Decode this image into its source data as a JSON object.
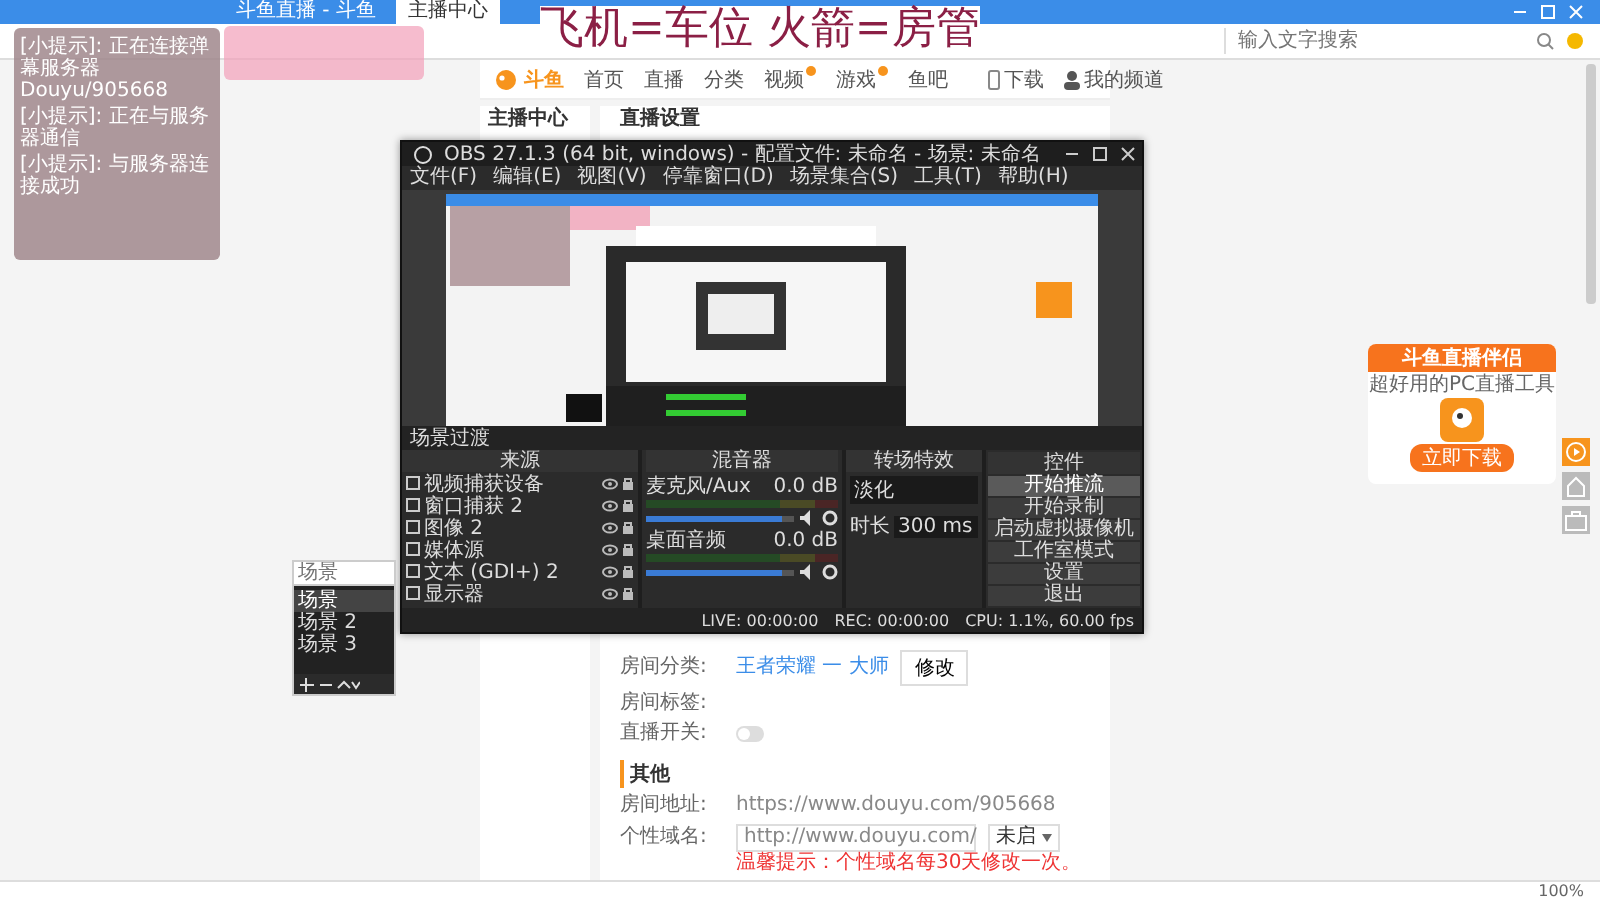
{
  "browser": {
    "tabs": [
      {
        "label": "斗鱼直播 - 斗鱼",
        "selected": false
      },
      {
        "label": "主播中心",
        "selected": true
      }
    ],
    "search": {
      "placeholder": "输入文字搜索"
    },
    "zoom": "100%"
  },
  "overlay_text": "飞机=车位 火箭=房管",
  "notes": [
    "[小提示]: 正在连接弹幕服务器 Douyu/905668",
    "[小提示]: 正在与服务器通信",
    "[小提示]: 与服务器连接成功"
  ],
  "site": {
    "logo": "斗鱼",
    "nav": [
      {
        "label": "首页",
        "hot": false
      },
      {
        "label": "直播",
        "hot": false
      },
      {
        "label": "分类",
        "hot": false
      },
      {
        "label": "视频",
        "hot": true
      },
      {
        "label": "游戏",
        "hot": true
      },
      {
        "label": "鱼吧",
        "hot": false
      }
    ],
    "download": "下载",
    "user": "我的频道"
  },
  "sidebar_title": "主播中心",
  "page_title": "直播设置",
  "settings": [
    {
      "label": "房间分类:",
      "value": "王者荣耀 一 大师",
      "button": "修改"
    },
    {
      "label": "房间标签:"
    },
    {
      "label": "直播开关:",
      "on": false
    }
  ],
  "other": {
    "title": "其他",
    "rows": [
      {
        "label": "房间地址:",
        "value": "https://www.douyu.com/905668"
      },
      {
        "label": "个性域名:",
        "value": "http://www.douyu.com/",
        "select": "未启",
        "hint": "温馨提示：个性域名每30天修改一次。"
      }
    ]
  },
  "obs": {
    "title": "OBS 27.1.3 (64 bit, windows) - 配置文件: 未命名 - 场景: 未命名",
    "menu": [
      "文件(F)",
      "编辑(E)",
      "视图(V)",
      "停靠窗口(D)",
      "场景集合(S)",
      "工具(T)",
      "帮助(H)"
    ],
    "transition_bar": "场景过渡",
    "scenes": {
      "placeholder": "场景",
      "items": [
        {
          "label": "场景",
          "selected": true
        },
        {
          "label": "场景 2",
          "selected": false
        },
        {
          "label": "场景 3",
          "selected": false
        }
      ]
    },
    "sources": {
      "title": "来源",
      "items": [
        "视频捕获设备",
        "窗口捕获 2",
        "图像 2",
        "媒体源",
        "文本 (GDI+) 2",
        "显示器"
      ]
    },
    "mixer": {
      "title": "混音器",
      "channels": [
        {
          "name": "麦克风/Aux",
          "reading": "0.0 dB",
          "level": 0.92
        },
        {
          "name": "桌面音频",
          "reading": "0.0 dB",
          "level": 0.92
        }
      ]
    },
    "transitions": {
      "title": "转场特效",
      "type": "淡化",
      "duration_label": "时长",
      "duration": "300 ms"
    },
    "controls": {
      "title": "控件",
      "buttons": [
        {
          "label": "开始推流",
          "selected": true
        },
        {
          "label": "开始录制",
          "selected": false
        },
        {
          "label": "启动虚拟摄像机",
          "selected": false
        },
        {
          "label": "工作室模式",
          "selected": false
        },
        {
          "label": "设置",
          "selected": false
        },
        {
          "label": "退出",
          "selected": false
        }
      ]
    },
    "status": [
      "LIVE: 00:00:00",
      "REC: 00:00:00",
      "CPU: 1.1%, 60.00 fps"
    ]
  },
  "promo": {
    "title": "斗鱼直播伴侣",
    "subtitle": "超好用的PC直播工具",
    "button": "立即下载"
  }
}
